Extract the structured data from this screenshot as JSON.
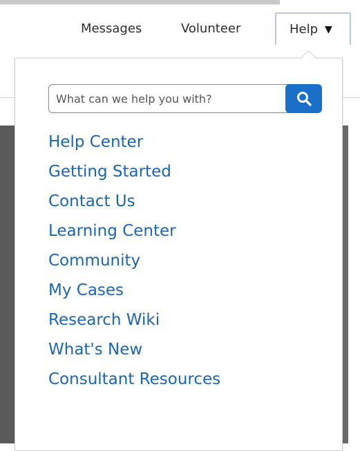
{
  "nav": {
    "messages_label": "Messages",
    "volunteer_label": "Volunteer",
    "help_label": "Help"
  },
  "search": {
    "placeholder": "What can we help you with?",
    "value": ""
  },
  "menu": {
    "items": [
      {
        "label": "Help Center"
      },
      {
        "label": "Getting Started"
      },
      {
        "label": "Contact Us"
      },
      {
        "label": "Learning Center"
      },
      {
        "label": "Community"
      },
      {
        "label": "My Cases"
      },
      {
        "label": "Research Wiki"
      },
      {
        "label": "What's New"
      },
      {
        "label": "Consultant Resources"
      }
    ]
  },
  "colors": {
    "link": "#1a66b4",
    "search_button": "#1a70c8",
    "text": "#2e2e2e"
  },
  "icons": {
    "search": "search-icon",
    "caret": "caret-down-icon"
  }
}
